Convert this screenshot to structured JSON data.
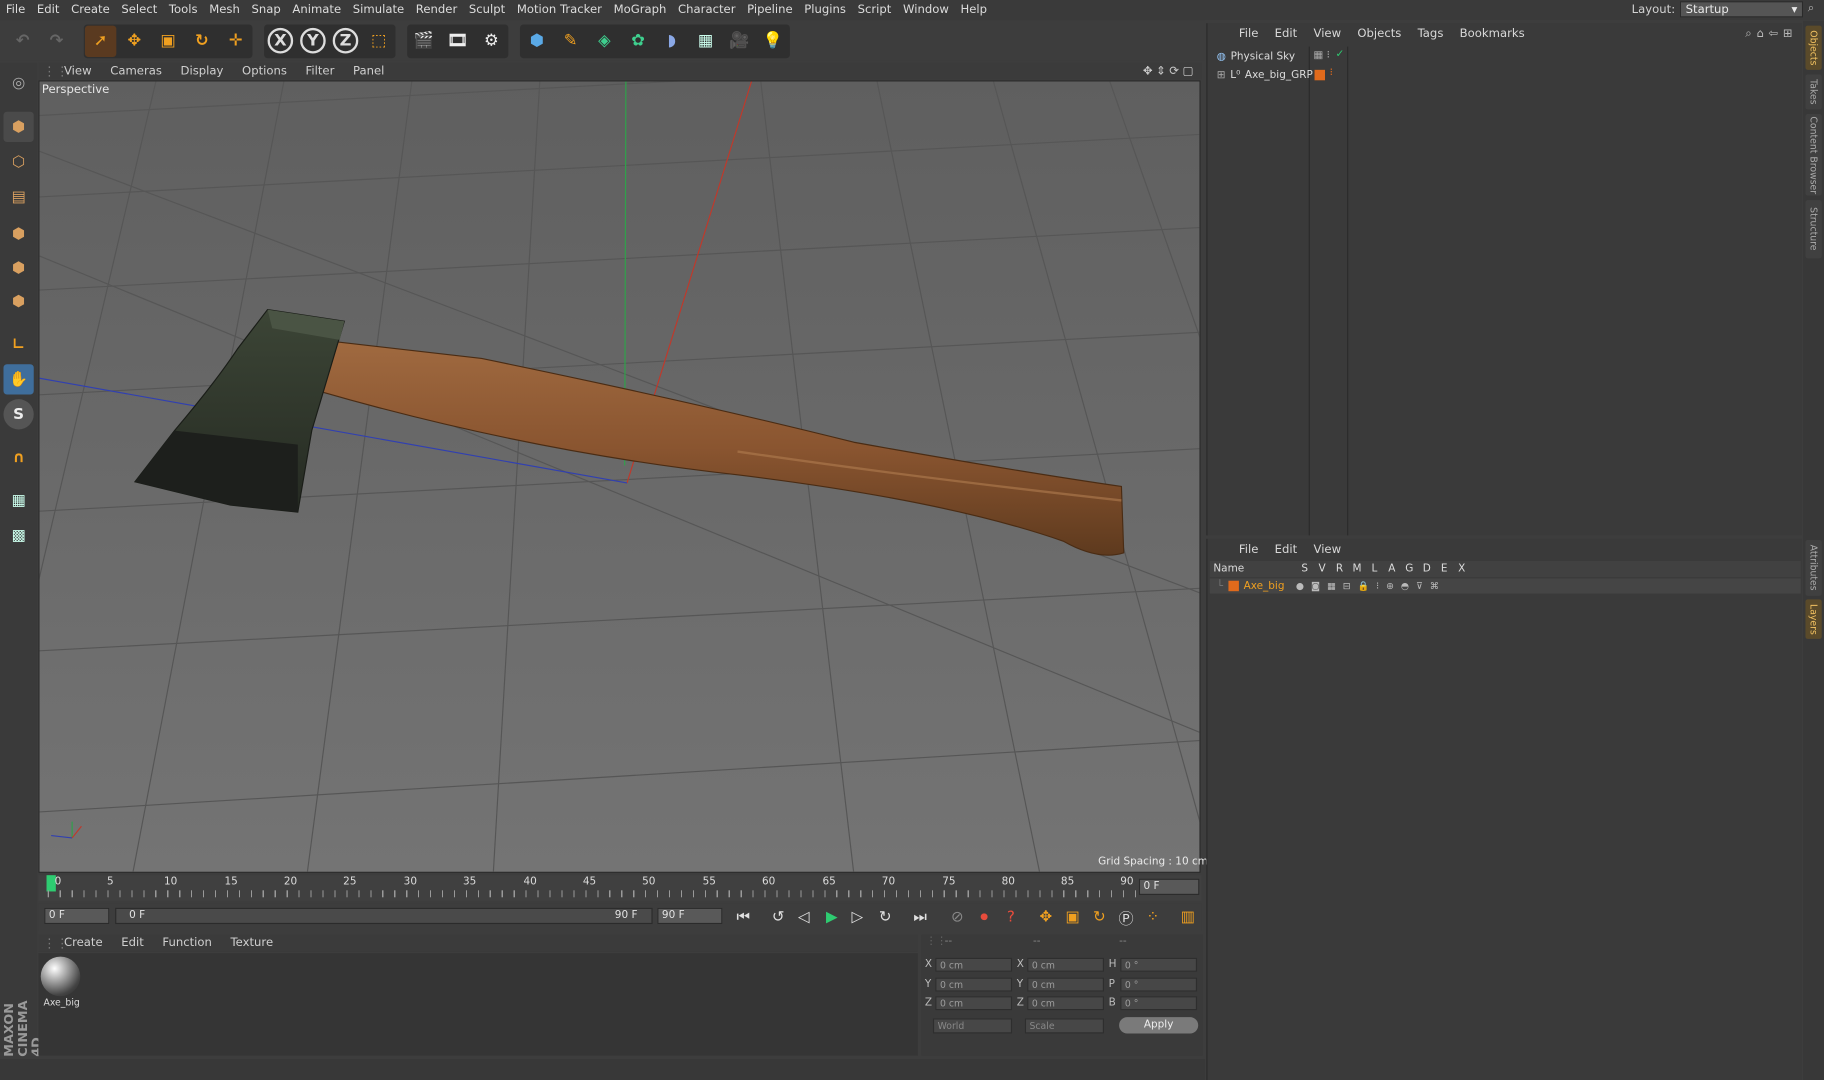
{
  "menubar": {
    "items": [
      "File",
      "Edit",
      "Create",
      "Select",
      "Tools",
      "Mesh",
      "Snap",
      "Animate",
      "Simulate",
      "Render",
      "Sculpt",
      "Motion Tracker",
      "MoGraph",
      "Character",
      "Pipeline",
      "Plugins",
      "Script",
      "Window",
      "Help"
    ],
    "layout_label": "Layout:",
    "layout_value": "Startup"
  },
  "viewport": {
    "menu": [
      "View",
      "Cameras",
      "Display",
      "Options",
      "Filter",
      "Panel"
    ],
    "label": "Perspective",
    "grid_spacing": "Grid Spacing : 10 cm"
  },
  "timeline": {
    "ticks": [
      "0",
      "5",
      "10",
      "15",
      "20",
      "25",
      "30",
      "35",
      "40",
      "45",
      "50",
      "55",
      "60",
      "65",
      "70",
      "75",
      "80",
      "85",
      "90"
    ],
    "current_frame": "0 F"
  },
  "playbar": {
    "start_field": "0 F",
    "range_start": "0 F",
    "range_end": "90 F",
    "end_field": "90 F"
  },
  "material_manager": {
    "menu": [
      "Create",
      "Edit",
      "Function",
      "Texture"
    ],
    "materials": [
      {
        "name": "Axe_big"
      }
    ]
  },
  "coordinates": {
    "header_left": "--",
    "header_mid": "--",
    "header_right": "--",
    "labels": {
      "x": "X",
      "y": "Y",
      "z": "Z",
      "h": "H",
      "p": "P",
      "b": "B"
    },
    "pos": {
      "x": "0 cm",
      "y": "0 cm",
      "z": "0 cm"
    },
    "size": {
      "x": "0 cm",
      "y": "0 cm",
      "z": "0 cm"
    },
    "rot": {
      "h": "0 °",
      "p": "0 °",
      "b": "0 °"
    },
    "mode_select": "World",
    "type_select": "Scale",
    "apply_label": "Apply"
  },
  "object_manager": {
    "menu": [
      "File",
      "Edit",
      "View",
      "Objects",
      "Tags",
      "Bookmarks"
    ],
    "objects": [
      {
        "name": "Physical Sky"
      },
      {
        "name": "Axe_big_GRP"
      }
    ]
  },
  "layer_manager": {
    "menu": [
      "File",
      "Edit",
      "View"
    ],
    "columns": [
      "Name",
      "S",
      "V",
      "R",
      "M",
      "L",
      "A",
      "G",
      "D",
      "E",
      "X"
    ],
    "layers": [
      {
        "name": "Axe_big",
        "color": "#e06a1c"
      }
    ]
  },
  "right_tabs": [
    "Objects",
    "Takes",
    "Content Browser",
    "Structure",
    "Attributes",
    "Layers"
  ],
  "logo": {
    "line1": "MAXON",
    "line2": "CINEMA 4D"
  },
  "colors": {
    "accent_orange": "#f0a020",
    "active_green": "#2ecc71",
    "axis_red": "#c0392b",
    "axis_green": "#27ae60",
    "axis_blue": "#2d3fa8"
  }
}
